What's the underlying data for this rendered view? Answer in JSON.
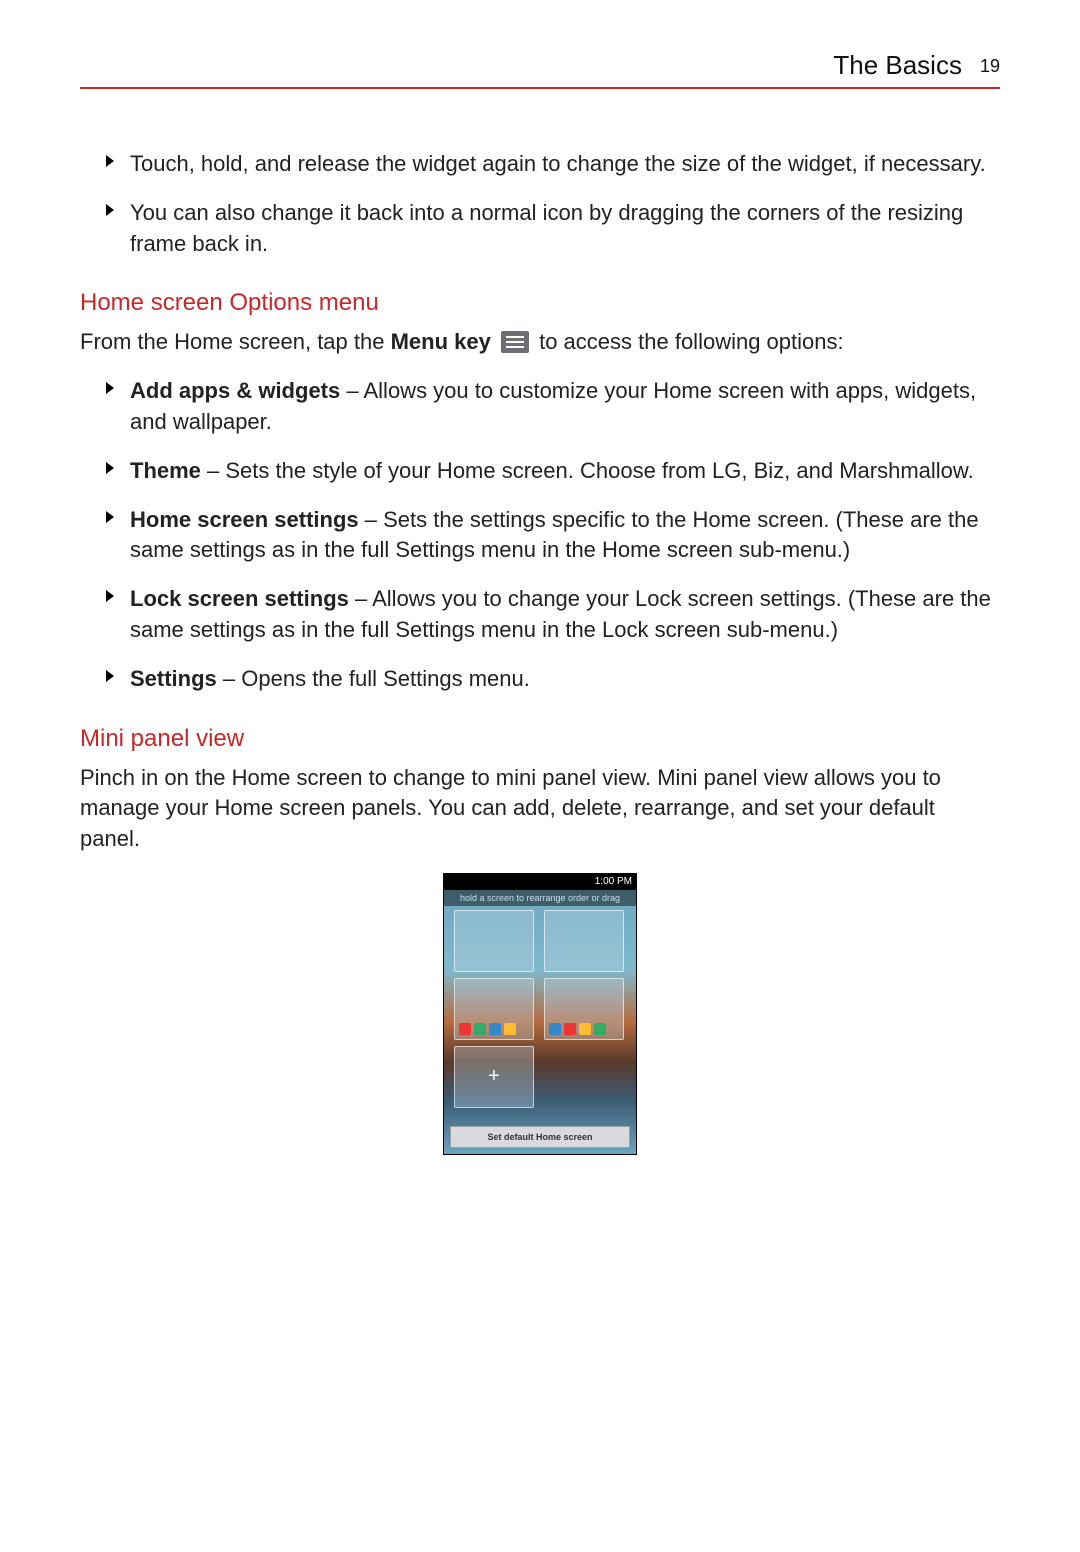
{
  "header": {
    "title": "The Basics",
    "page_number": "19"
  },
  "intro_bullets": [
    "Touch, hold, and release the widget again to change the size of the widget, if necessary.",
    "You can also change it back into a normal icon by dragging the corners of the resizing frame back in."
  ],
  "section1": {
    "heading": "Home screen Options menu",
    "lead_pre": "From the Home screen, tap the ",
    "lead_bold": "Menu key",
    "lead_post": " to access the following options:",
    "items": [
      {
        "term": "Add apps & widgets",
        "desc": " – Allows you to customize your Home screen with apps, widgets, and wallpaper."
      },
      {
        "term": "Theme",
        "desc": " – Sets the style of your Home screen. Choose from LG, Biz, and Marshmallow."
      },
      {
        "term": "Home screen settings",
        "desc": " – Sets the settings specific to the Home screen. (These are the same settings as in the full Settings menu in the Home screen sub-menu.)"
      },
      {
        "term": "Lock screen settings",
        "desc": " – Allows you to change your Lock screen settings. (These are the same settings as in the full Settings menu in the Lock screen sub-menu.)"
      },
      {
        "term": "Settings",
        "desc": " – Opens the full Settings menu."
      }
    ]
  },
  "section2": {
    "heading": "Mini panel view",
    "para": "Pinch in on the Home screen to change to mini panel view. Mini panel view allows you to manage your Home screen panels. You can add, delete, rearrange, and set your default panel."
  },
  "phone": {
    "status_time": "1:00 PM",
    "hint": "hold a screen to rearrange order or drag",
    "add_symbol": "+",
    "bottom_button": "Set default Home screen"
  },
  "colors": {
    "accent": "#c62828"
  }
}
